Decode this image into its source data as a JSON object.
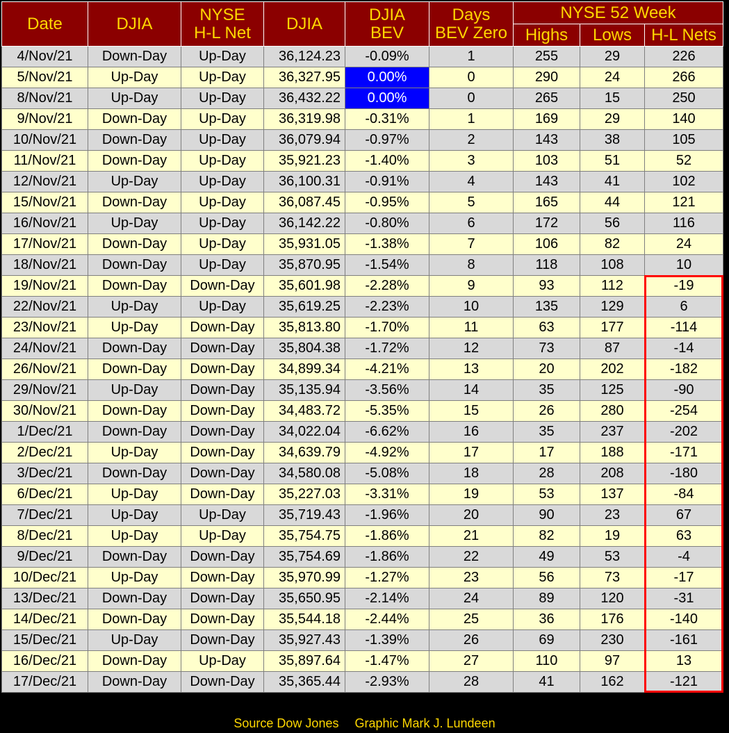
{
  "chart_data": {
    "type": "table",
    "header": {
      "date": "Date",
      "djia_day": "DJIA",
      "nyse_hl_net_line1": "NYSE",
      "nyse_hl_net_line2": "H-L Net",
      "djia": "DJIA",
      "bev_line1": "DJIA",
      "bev_line2": "BEV",
      "days_line1": "Days",
      "days_line2": "BEV Zero",
      "group": "NYSE 52 Week",
      "highs": "Highs",
      "lows": "Lows",
      "nets": "H-L Nets"
    },
    "rows": [
      [
        "4/Nov/21",
        "Down-Day",
        "Up-Day",
        "36,124.23",
        "-0.09%",
        "1",
        "255",
        "29",
        "226"
      ],
      [
        "5/Nov/21",
        "Up-Day",
        "Up-Day",
        "36,327.95",
        "0.00%",
        "0",
        "290",
        "24",
        "266"
      ],
      [
        "8/Nov/21",
        "Up-Day",
        "Up-Day",
        "36,432.22",
        "0.00%",
        "0",
        "265",
        "15",
        "250"
      ],
      [
        "9/Nov/21",
        "Down-Day",
        "Up-Day",
        "36,319.98",
        "-0.31%",
        "1",
        "169",
        "29",
        "140"
      ],
      [
        "10/Nov/21",
        "Down-Day",
        "Up-Day",
        "36,079.94",
        "-0.97%",
        "2",
        "143",
        "38",
        "105"
      ],
      [
        "11/Nov/21",
        "Down-Day",
        "Up-Day",
        "35,921.23",
        "-1.40%",
        "3",
        "103",
        "51",
        "52"
      ],
      [
        "12/Nov/21",
        "Up-Day",
        "Up-Day",
        "36,100.31",
        "-0.91%",
        "4",
        "143",
        "41",
        "102"
      ],
      [
        "15/Nov/21",
        "Down-Day",
        "Up-Day",
        "36,087.45",
        "-0.95%",
        "5",
        "165",
        "44",
        "121"
      ],
      [
        "16/Nov/21",
        "Up-Day",
        "Up-Day",
        "36,142.22",
        "-0.80%",
        "6",
        "172",
        "56",
        "116"
      ],
      [
        "17/Nov/21",
        "Down-Day",
        "Up-Day",
        "35,931.05",
        "-1.38%",
        "7",
        "106",
        "82",
        "24"
      ],
      [
        "18/Nov/21",
        "Down-Day",
        "Up-Day",
        "35,870.95",
        "-1.54%",
        "8",
        "118",
        "108",
        "10"
      ],
      [
        "19/Nov/21",
        "Down-Day",
        "Down-Day",
        "35,601.98",
        "-2.28%",
        "9",
        "93",
        "112",
        "-19"
      ],
      [
        "22/Nov/21",
        "Up-Day",
        "Up-Day",
        "35,619.25",
        "-2.23%",
        "10",
        "135",
        "129",
        "6"
      ],
      [
        "23/Nov/21",
        "Up-Day",
        "Down-Day",
        "35,813.80",
        "-1.70%",
        "11",
        "63",
        "177",
        "-114"
      ],
      [
        "24/Nov/21",
        "Down-Day",
        "Down-Day",
        "35,804.38",
        "-1.72%",
        "12",
        "73",
        "87",
        "-14"
      ],
      [
        "26/Nov/21",
        "Down-Day",
        "Down-Day",
        "34,899.34",
        "-4.21%",
        "13",
        "20",
        "202",
        "-182"
      ],
      [
        "29/Nov/21",
        "Up-Day",
        "Down-Day",
        "35,135.94",
        "-3.56%",
        "14",
        "35",
        "125",
        "-90"
      ],
      [
        "30/Nov/21",
        "Down-Day",
        "Down-Day",
        "34,483.72",
        "-5.35%",
        "15",
        "26",
        "280",
        "-254"
      ],
      [
        "1/Dec/21",
        "Down-Day",
        "Down-Day",
        "34,022.04",
        "-6.62%",
        "16",
        "35",
        "237",
        "-202"
      ],
      [
        "2/Dec/21",
        "Up-Day",
        "Down-Day",
        "34,639.79",
        "-4.92%",
        "17",
        "17",
        "188",
        "-171"
      ],
      [
        "3/Dec/21",
        "Down-Day",
        "Down-Day",
        "34,580.08",
        "-5.08%",
        "18",
        "28",
        "208",
        "-180"
      ],
      [
        "6/Dec/21",
        "Up-Day",
        "Down-Day",
        "35,227.03",
        "-3.31%",
        "19",
        "53",
        "137",
        "-84"
      ],
      [
        "7/Dec/21",
        "Up-Day",
        "Up-Day",
        "35,719.43",
        "-1.96%",
        "20",
        "90",
        "23",
        "67"
      ],
      [
        "8/Dec/21",
        "Up-Day",
        "Up-Day",
        "35,754.75",
        "-1.86%",
        "21",
        "82",
        "19",
        "63"
      ],
      [
        "9/Dec/21",
        "Down-Day",
        "Down-Day",
        "35,754.69",
        "-1.86%",
        "22",
        "49",
        "53",
        "-4"
      ],
      [
        "10/Dec/21",
        "Up-Day",
        "Down-Day",
        "35,970.99",
        "-1.27%",
        "23",
        "56",
        "73",
        "-17"
      ],
      [
        "13/Dec/21",
        "Down-Day",
        "Down-Day",
        "35,650.95",
        "-2.14%",
        "24",
        "89",
        "120",
        "-31"
      ],
      [
        "14/Dec/21",
        "Down-Day",
        "Down-Day",
        "35,544.18",
        "-2.44%",
        "25",
        "36",
        "176",
        "-140"
      ],
      [
        "15/Dec/21",
        "Up-Day",
        "Down-Day",
        "35,927.43",
        "-1.39%",
        "26",
        "69",
        "230",
        "-161"
      ],
      [
        "16/Dec/21",
        "Down-Day",
        "Up-Day",
        "35,897.64",
        "-1.47%",
        "27",
        "110",
        "97",
        "13"
      ],
      [
        "17/Dec/21",
        "Down-Day",
        "Down-Day",
        "35,365.44",
        "-2.93%",
        "28",
        "41",
        "162",
        "-121"
      ]
    ],
    "highlighted_bev_zero_rows": [
      1,
      2
    ],
    "highlighted_nets_range": [
      11,
      30
    ]
  },
  "footer": {
    "source": "Source Dow Jones",
    "credit": "Graphic Mark J. Lundeen"
  },
  "colors": {
    "header_bg": "#8B0000",
    "header_text": "#FFD700",
    "row_odd": "#d9d9d9",
    "row_even": "#ffffcc",
    "bev_zero_bg": "#0000ff",
    "highlight_border": "#ff0000",
    "background": "#000000"
  }
}
